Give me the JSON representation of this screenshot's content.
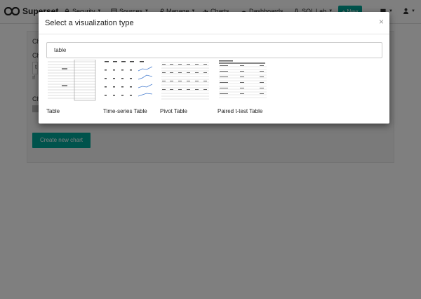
{
  "navbar": {
    "brand": "Superset",
    "items": [
      {
        "label": "Security",
        "icon": "lock-icon",
        "has_caret": true
      },
      {
        "label": "Sources",
        "icon": "database-icon",
        "has_caret": true
      },
      {
        "label": "Manage",
        "icon": "wrench-icon",
        "has_caret": true
      },
      {
        "label": "Charts",
        "icon": "chart-icon",
        "has_caret": false
      },
      {
        "label": "Dashboards",
        "icon": "dashboard-icon",
        "has_caret": false
      },
      {
        "label": "SQL Lab",
        "icon": "flask-icon",
        "has_caret": true
      }
    ],
    "new_button": "+ New",
    "right_icons": [
      "flag-icon",
      "user-icon"
    ]
  },
  "page": {
    "label_1": "Ch",
    "label_2": "Ch",
    "input_value": "t",
    "hint": "If",
    "label_3": "Ch",
    "create_button": "Create new chart"
  },
  "modal": {
    "title": "Select a visualization type",
    "close_glyph": "×",
    "search_value": "table",
    "visualizations": [
      {
        "label": "Table"
      },
      {
        "label": "Time-series Table"
      },
      {
        "label": "Pivot Table"
      },
      {
        "label": "Paired t-test Table"
      }
    ]
  },
  "colors": {
    "accent": "#00a699",
    "backdrop": "rgba(0,0,0,0.5)"
  }
}
